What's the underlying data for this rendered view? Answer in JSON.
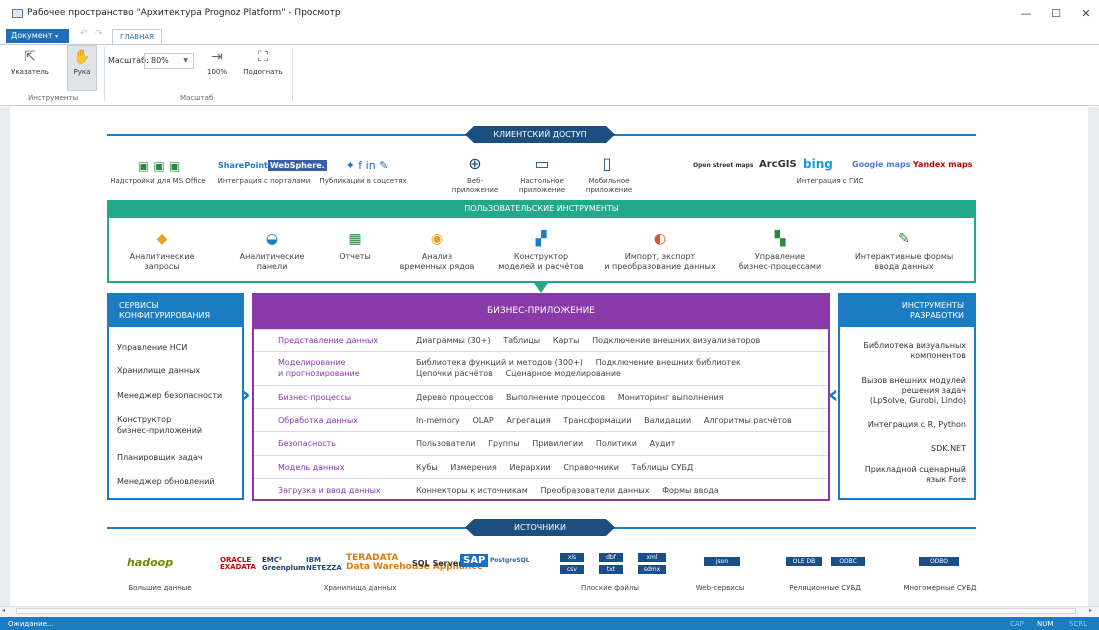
{
  "window": {
    "title": "Рабочее пространство \"Архитектура Prognoz Platform\" - Просмотр",
    "minimize": "—",
    "maximize": "☐",
    "close": "✕"
  },
  "menu": {
    "document": "Документ",
    "tab_main": "ГЛАВНАЯ"
  },
  "ribbon": {
    "pointer": "Указатель",
    "hand": "Рука",
    "group_tools": "Инструменты",
    "zoom_label": "Масштаб:",
    "zoom_value": "80%",
    "btn_100": "100%",
    "btn_fit": "Подогнать",
    "group_zoom": "Масштаб"
  },
  "diagram": {
    "client_access": "КЛИЕНТСКИЙ ДОСТУП",
    "client_items": [
      "Надстройки для MS Office",
      "Интеграция с порталами",
      "Публикации в соцсетях",
      "Веб-\nприложение",
      "Настольное\nприложение",
      "Мобильное\nприложение",
      "Интеграция с ГИС"
    ],
    "portal_logos": [
      "SharePoint",
      "WebSphere."
    ],
    "gis_logos": [
      "Open street maps",
      "ArcGIS",
      "bing",
      "Google maps",
      "Yandex maps"
    ],
    "user_tools": "ПОЛЬЗОВАТЕЛЬСКИЕ ИНСТРУМЕНТЫ",
    "tools": [
      "Аналитические\nзапросы",
      "Аналитические\nпанели",
      "Отчеты",
      "Анализ\nвременных рядов",
      "Конструктор\nмоделей и расчётов",
      "Импорт, экспорт\nи преобразование данных",
      "Управление\nбизнес-процессами",
      "Интерактивные формы\nввода данных"
    ],
    "config_services": "СЕРВИСЫ\nКОНФИГУРИРОВАНИЯ",
    "config_items": [
      "Управление НСИ",
      "Хранилище данных",
      "Менеджер безопасности",
      "Конструктор\nбизнес-приложений",
      "Планировщик задач",
      "Менеджер обновлений"
    ],
    "business_app": "БИЗНЕС-ПРИЛОЖЕНИЕ",
    "business_rows": [
      {
        "name": "Представление данных",
        "value": "Диаграммы (30+)     Таблицы     Карты     Подключение внешних визуализаторов"
      },
      {
        "name": "Моделирование\nи прогнозирование",
        "value": "Библиотека функций и методов (300+)     Подключение внешних библиотек\nЦепочки расчётов     Сценарное моделирование"
      },
      {
        "name": "Бизнес-процессы",
        "value": "Дерево процессов     Выполнение процессов     Мониторинг выполнения"
      },
      {
        "name": "Обработка данных",
        "value": "In-memory     OLAP     Агрегация     Трансформации     Валидации     Алгоритмы расчётов"
      },
      {
        "name": "Безопасность",
        "value": "Пользователи     Группы     Привилегии     Политики     Аудит"
      },
      {
        "name": "Модель данных",
        "value": "Кубы     Измерения     Иерархии     Справочники     Таблицы СУБД"
      },
      {
        "name": "Загрузка и ввод данных",
        "value": "Коннекторы к источникам     Преобразователи данных     Формы ввода"
      }
    ],
    "dev_tools": "ИНСТРУМЕНТЫ\nРАЗРАБОТКИ",
    "dev_items": [
      "Библиотека визуальных\nкомпонентов",
      "Вызов внешних модулей\nрешения задач\n(LpSolve, Gurobi, Lindo)",
      "Интеграция с R, Python",
      "SDK.NET",
      "Прикладной сценарный\nязык Fore"
    ],
    "sources": "ИСТОЧНИКИ",
    "source_labels": [
      "Большие данные",
      "Хранилища данных",
      "Плоские файлы",
      "Web-сервисы",
      "Реляционные СУБД",
      "Многомерные СУБД"
    ],
    "bigdata_logo": "hadoop",
    "dw_logos": [
      "ORACLE\nEXADATA",
      "EMC²\nGreenplum",
      "IBM\nNETEZZA",
      "TERADATA\nData Warehouse Appliance",
      "SQL Server",
      "SAP",
      "PostgreSQL"
    ],
    "file_chips": [
      "xls",
      "dbf",
      "xml",
      "csv",
      "txt",
      "sdmx"
    ],
    "web_chips": [
      "json"
    ],
    "rel_chips": [
      "OLE DB",
      "ODBC"
    ],
    "olap_chips": [
      "ODBO"
    ]
  },
  "status": {
    "left": "Ожидание...",
    "cap": "CAP",
    "num": "NUM",
    "scrl": "SCRL"
  },
  "colors": {
    "accent_blue": "#1a7cc1",
    "banner_navy": "#1b4f80",
    "teal": "#22a88a",
    "purple": "#8a3aa8"
  }
}
